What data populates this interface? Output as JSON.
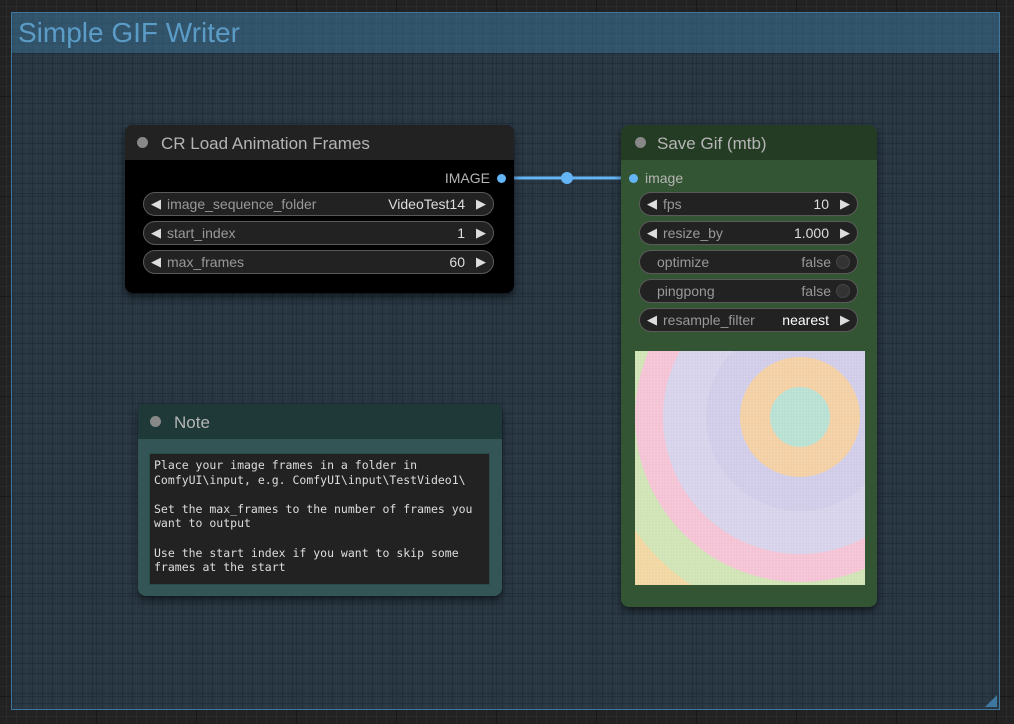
{
  "group": {
    "title": "Simple GIF Writer"
  },
  "load_node": {
    "title": "CR Load Animation Frames",
    "output_label": "IMAGE",
    "widgets": [
      {
        "name": "image_sequence_folder",
        "value": "VideoTest14"
      },
      {
        "name": "start_index",
        "value": "1"
      },
      {
        "name": "max_frames",
        "value": "60"
      }
    ]
  },
  "save_node": {
    "title": "Save Gif (mtb)",
    "input_label": "image",
    "widgets": [
      {
        "name": "fps",
        "value": "10"
      },
      {
        "name": "resize_by",
        "value": "1.000"
      },
      {
        "name": "optimize",
        "value": "false"
      },
      {
        "name": "pingpong",
        "value": "false"
      },
      {
        "name": "resample_filter",
        "value": "nearest"
      }
    ]
  },
  "note_node": {
    "title": "Note",
    "text": "Place your image frames in a folder in\nComfyUI\\input, e.g. ComfyUI\\input\\TestVideo1\\\n\nSet the max_frames to the number of frames you\nwant to output\n\nUse the start index if you want to skip some\nframes at the start"
  },
  "colors": {
    "link": "#64b5f6",
    "group_border": "#3f789e",
    "save_node_bg": "#335533",
    "note_node_bg": "#335555"
  },
  "icons": {
    "arrow_left": "◀",
    "arrow_right": "▶"
  }
}
